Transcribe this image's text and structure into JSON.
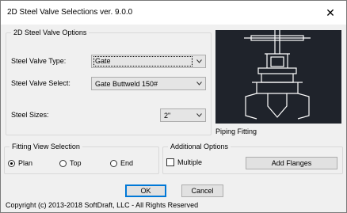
{
  "window": {
    "title": "2D Steel Valve Selections ver. 9.0.0",
    "close_glyph": "✕"
  },
  "options_group": {
    "label": "2D Steel Valve Options",
    "type_label": "Steel Valve Type:",
    "type_value": "Gate",
    "select_label": "Steel Valve Select:",
    "select_value": "Gate Buttweld 150#",
    "size_label": "Steel Sizes:",
    "size_value": "2\""
  },
  "preview": {
    "caption": "Piping Fitting"
  },
  "view_group": {
    "label": "Fitting View Selection",
    "options": [
      "Plan",
      "Top",
      "End"
    ],
    "selected": "Plan"
  },
  "additional_group": {
    "label": "Additional Options",
    "multiple_label": "Multiple",
    "multiple_checked": false,
    "add_flanges_label": "Add Flanges"
  },
  "buttons": {
    "ok": "OK",
    "cancel": "Cancel"
  },
  "footer": {
    "copyright": "Copyright (c) 2013-2018 SoftDraft, LLC - All Rights Reserved"
  }
}
